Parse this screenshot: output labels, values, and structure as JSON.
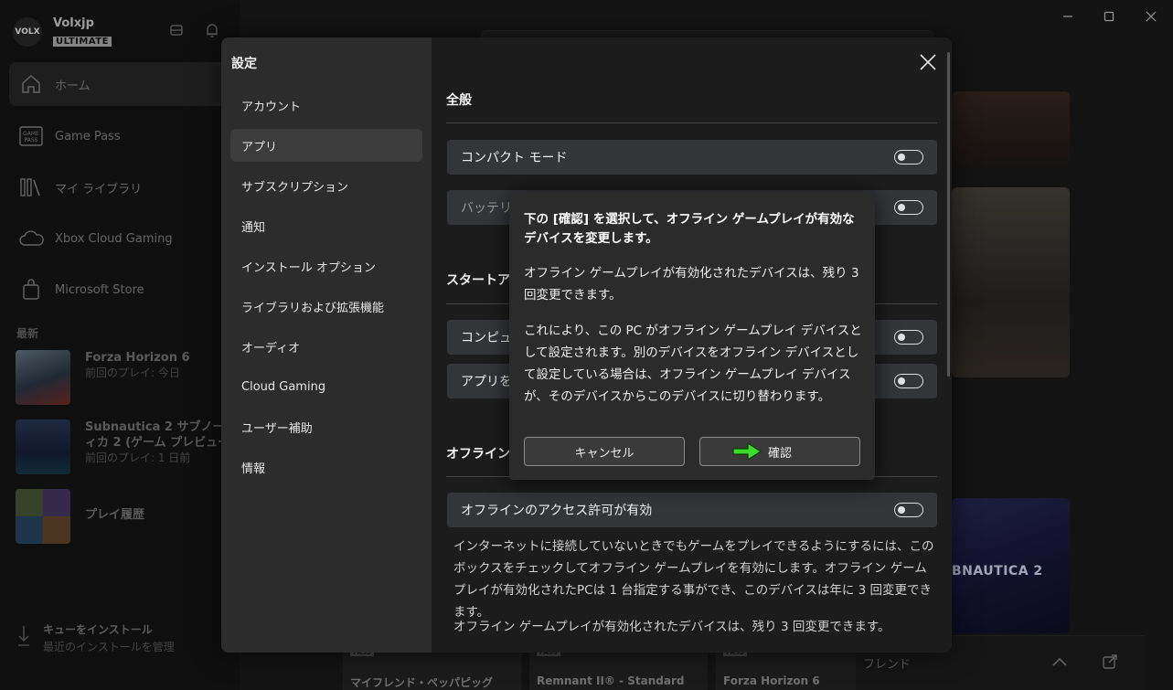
{
  "profile": {
    "avatar_text": "VOLX",
    "name": "Volxjp",
    "tier": "ULTIMATE"
  },
  "sidebar": {
    "nav": [
      {
        "label": "ホーム",
        "icon": "home-icon"
      },
      {
        "label": "Game Pass",
        "icon": "game-pass-icon"
      },
      {
        "label": "マイ ライブラリ",
        "icon": "library-icon"
      },
      {
        "label": "Xbox Cloud Gaming",
        "icon": "cloud-icon"
      },
      {
        "label": "Microsoft Store",
        "icon": "store-icon"
      }
    ],
    "recent_label": "最新",
    "recent": [
      {
        "title": "Forza Horizon 6",
        "sub": "前回のプレイ: 今日"
      },
      {
        "title": "Subnautica 2 サブノーティカ 2 (ゲーム プレビュー)",
        "sub": "前回のプレイ: 1 日前"
      },
      {
        "title": "プレイ履歴",
        "sub": ""
      }
    ],
    "queue": {
      "title": "キューをインストール",
      "sub": "最近のインストールを管理"
    }
  },
  "background": {
    "cards": [
      {
        "pass": "PASS",
        "name": "マイフレンド・ペッパピッグ"
      },
      {
        "pass": "PASS",
        "name": "Remnant II® - Standard"
      },
      {
        "pass": "PASS",
        "name": "Forza Horizon 6"
      }
    ],
    "friends_label": "フレンド",
    "game_art_text": "BNAUTICA 2"
  },
  "settings": {
    "title": "設定",
    "menu": [
      "アカウント",
      "アプリ",
      "サブスクリプション",
      "通知",
      "インストール オプション",
      "ライブラリおよび拡張機能",
      "オーディオ",
      "Cloud Gaming",
      "ユーザー補助",
      "情報"
    ],
    "active_index": 1,
    "sections": {
      "general": "全般",
      "startup": "スタートアップ",
      "offline": "オフラインの"
    },
    "rows": {
      "compact": "コンパクト モード",
      "battery": "バッテリー",
      "computer": "コンピュー",
      "apps": "アプリを終",
      "offline_access": "オフラインのアクセス許可が有効"
    },
    "offline_desc1": "インターネットに接続していないときでもゲームをプレイできるようにするには、このボックスをチェックしてオフライン ゲームプレイを有効にします。オフライン ゲームプレイが有効化されたPCは 1 台指定する事ができ、このデバイスは年に 3 回変更できます。",
    "offline_desc2": "オフライン ゲームプレイが有効化されたデバイスは、残り 3 回変更できます。"
  },
  "confirm": {
    "title": "下の [確認] を選択して、オフライン ゲームプレイが有効なデバイスを変更します。",
    "p1": "オフライン ゲームプレイが有効化されたデバイスは、残り 3 回変更できます。",
    "p2": "これにより、この PC がオフライン ゲームプレイ デバイスとして設定されます。別のデバイスをオフライン デバイスとして設定している場合は、オフライン ゲームプレイ デバイスが、そのデバイスからこのデバイスに切り替わります。",
    "cancel": "キャンセル",
    "ok": "確認"
  },
  "colors": {
    "arrow": "#3ddc2a",
    "toggle": "#e0e0e0"
  }
}
